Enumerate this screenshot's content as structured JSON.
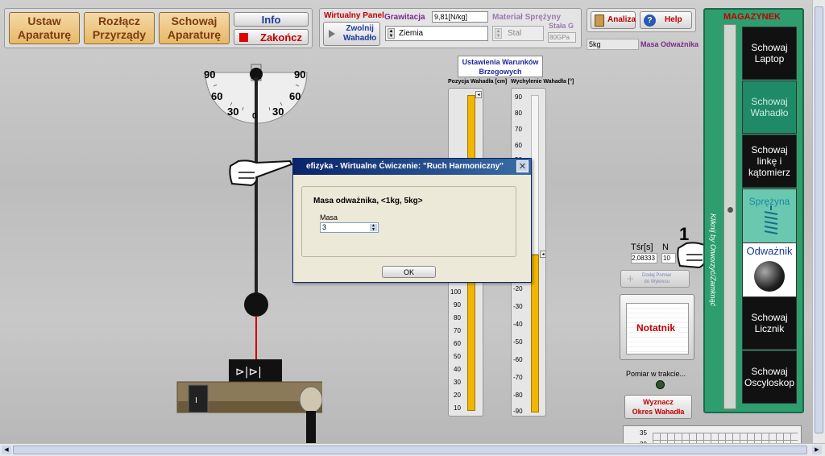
{
  "toolbar": {
    "ustaw": "Ustaw\nAparaturę",
    "rozlacz": "Rozłącz\nPrzyrządy",
    "schowaj": "Schowaj\nAparaturę",
    "info": "Info",
    "zakoncz": "Zakończ"
  },
  "params": {
    "wirtualny_panel": "Wirtualny Panel",
    "zwolnij": "Zwolnij\nWahadło",
    "grawitacja_label": "Grawitacja",
    "grawitacja_value": "9,81[N/kg]",
    "planet": "Ziemia",
    "material_label": "Materiał Sprężyny",
    "material_value": "Stal",
    "stala_label": "Stała G",
    "stala_value": "80GPa",
    "masa_value": "5kg",
    "masa_label": "Masa Odważnika"
  },
  "top_right": {
    "analiza": "Analiza",
    "help": "Help"
  },
  "protractor": {
    "l90": "90",
    "r90": "90",
    "l60": "60",
    "r60": "60",
    "l30": "30",
    "r30": "30",
    "zero": "0"
  },
  "conditions": {
    "title": "Ustawienia Warunków\nBrzegowych",
    "pozycja_label": "Pozycja Wahadła [cm]",
    "wychylenie_label": "Wychylenie Wahadła [°]",
    "pozycja_ticks": [
      "100",
      "90",
      "80",
      "70",
      "60",
      "50",
      "40",
      "30",
      "20",
      "10"
    ],
    "wychylenie_top_ticks": [
      "90",
      "80",
      "70",
      "60",
      "50"
    ],
    "wychylenie_bottom_ticks": [
      "-20",
      "-30",
      "-40",
      "-50",
      "-60",
      "-70",
      "-80",
      "-90"
    ]
  },
  "dialog": {
    "title": "efizyka - Wirtualne Ćwiczenie: \"Ruch Harmoniczny\"",
    "prompt": "Masa odważnika, <1kg, 5kg>",
    "field_label": "Masa",
    "field_value": "3",
    "ok": "OK"
  },
  "measure": {
    "tsr_label": "Tśr[s]",
    "n_label": "N",
    "tsr_value": "2,08333",
    "n_value": "10",
    "dodaj": "Dodaj Pomiar\ndo Wykresu",
    "notatnik": "Notatnik",
    "status": "Pomiar w trakcie...",
    "wyznacz": "Wyznacz\nOkres Wahadła",
    "graph_ticks": [
      "35",
      "30"
    ]
  },
  "magazynek": {
    "title": "MAGAZYNEK",
    "side_label": "Kliknij by Otworzyć/Zamknąć",
    "items": [
      {
        "label": "Schowaj\nLaptop",
        "style": "dark"
      },
      {
        "label": "Schowaj\nWahadło",
        "style": "teal"
      },
      {
        "label": "Schowaj\nlinkę i\nkątomierz",
        "style": "dark"
      },
      {
        "label": "Sprężyna",
        "style": "spring"
      },
      {
        "label": "Odważnik",
        "style": "weight"
      },
      {
        "label": "Schowaj\nLicznik",
        "style": "dark"
      },
      {
        "label": "Schowaj\nOscyloskop",
        "style": "dark"
      }
    ]
  },
  "annotation": {
    "number": "1"
  },
  "colors": {
    "accent_red": "#cc0000",
    "magazyn_green": "#2e9e6e",
    "ruler_fill": "#f2b500"
  }
}
